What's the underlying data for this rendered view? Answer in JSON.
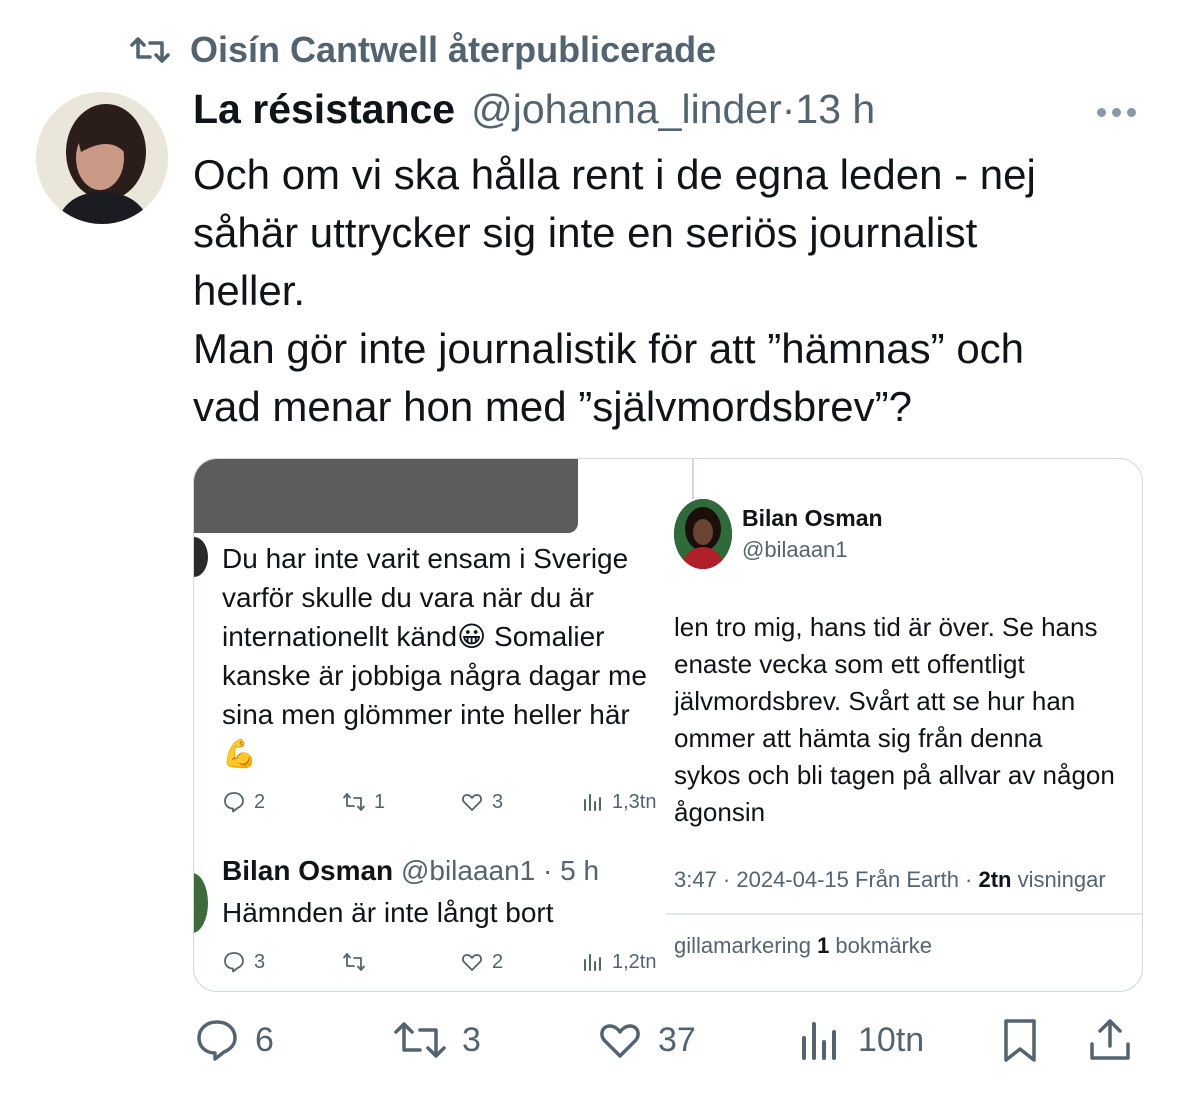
{
  "repost": {
    "label": "Oisín Cantwell återpublicerade"
  },
  "tweet": {
    "display_name": "La résistance",
    "handle": "@johanna_linder",
    "separator": "·",
    "time": "13 h",
    "text_lines": [
      "Och om vi ska hålla rent i de egna leden - nej",
      "såhär uttrycker sig inte en seriös journalist",
      "heller.",
      "Man gör inte journalistik för att ”hämnas” och",
      "vad menar hon med ”självmordsbrev”?"
    ]
  },
  "embedded": {
    "left": {
      "reply_lines": [
        "Du har inte varit ensam i Sverige",
        "varför skulle du vara när du är",
        "internationellt känd😀 Somalier",
        "kanske är jobbiga några dagar me",
        "sina men glömmer inte heller här",
        "💪"
      ],
      "stats1": {
        "replies": "2",
        "reposts": "1",
        "likes": "3",
        "views": "1,3tn"
      },
      "reply2": {
        "name": "Bilan Osman",
        "meta": "@bilaaan1 · 5 h",
        "text": "Hämnden är inte långt bort"
      },
      "stats2": {
        "replies": "3",
        "reposts": "",
        "likes": "2",
        "views": "1,2tn"
      }
    },
    "right": {
      "name": "Bilan Osman",
      "handle": "@bilaaan1",
      "text_lines": [
        "len tro mig, hans tid är över. Se hans",
        "enaste vecka som ett offentligt",
        "jälvmordsbrev. Svårt att se hur han",
        "ommer att hämta sig från denna",
        "sykos och bli tagen på allvar av någon",
        "ågonsin"
      ],
      "meta_time": "3:47 · 2024-04-15 Från Earth · ",
      "meta_views_count": "2tn",
      "meta_views_label": " visningar",
      "likes_label": "gillamarkering ",
      "bookmarks_count": "1",
      "bookmarks_label": " bokmärke"
    }
  },
  "actions": {
    "replies": "6",
    "reposts": "3",
    "likes": "37",
    "views": "10tn"
  },
  "colors": {
    "text": "#0f1419",
    "muted": "#536471",
    "border": "#cfd9de"
  }
}
